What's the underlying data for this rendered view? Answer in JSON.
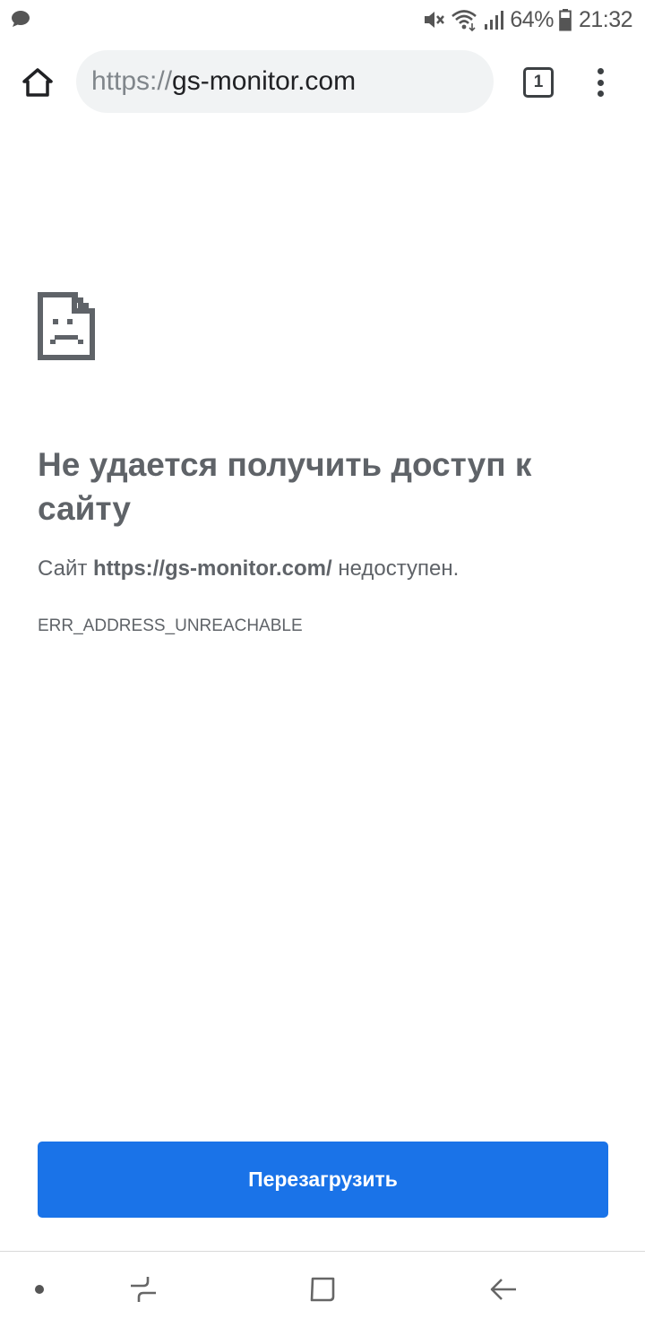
{
  "status_bar": {
    "notification_icon": "message-bubble-icon",
    "icons": [
      "mute-icon",
      "wifi-icon",
      "signal-icon",
      "battery-icon"
    ],
    "battery": "64%",
    "time": "21:32"
  },
  "toolbar": {
    "home_icon": "home-icon",
    "url_scheme": "https://",
    "url_host": "gs-monitor.com",
    "tab_count": "1",
    "menu_icon": "more-vert-icon"
  },
  "error_page": {
    "icon": "sad-document-icon",
    "title": "Не удается получить доступ к сайту",
    "desc_prefix": "Сайт ",
    "desc_url": "https://gs-monitor.com/",
    "desc_suffix": " недоступен.",
    "code": "ERR_ADDRESS_UNREACHABLE",
    "reload_label": "Перезагрузить"
  },
  "nav_bar": {
    "items": [
      "dot-icon",
      "recents-icon",
      "home-square-icon",
      "back-arrow-icon"
    ]
  },
  "colors": {
    "accent": "#1a73e8",
    "text": "#5f6368",
    "omnibox_bg": "#f1f3f4"
  }
}
